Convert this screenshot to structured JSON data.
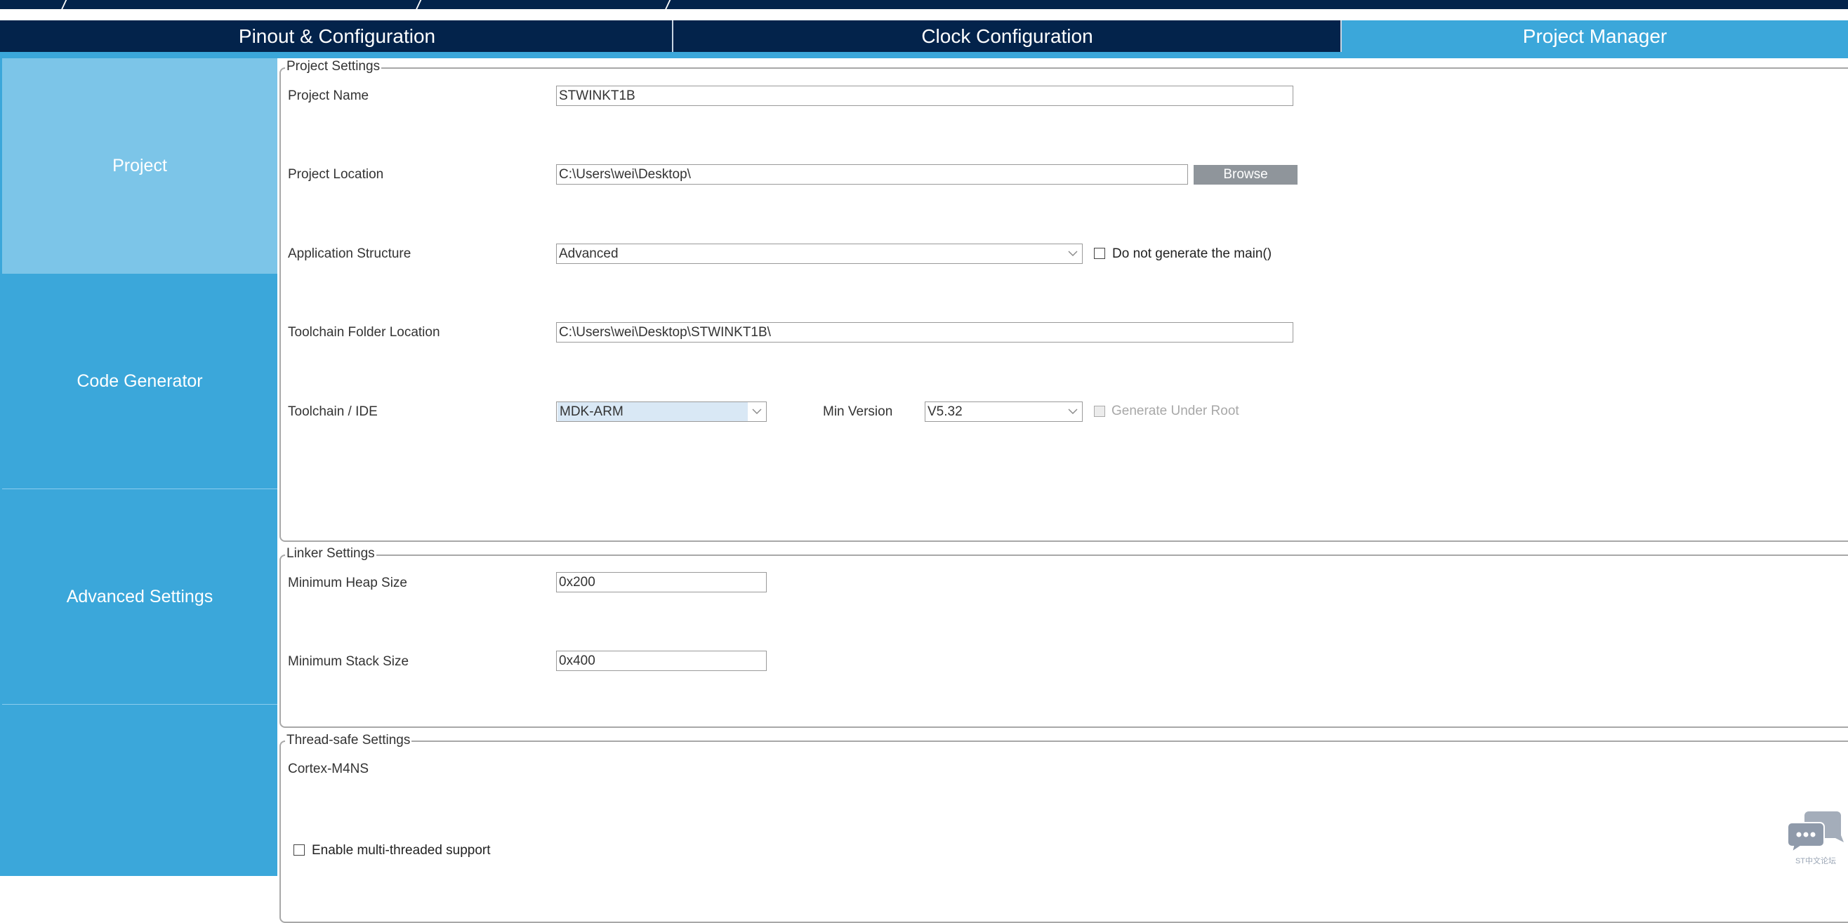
{
  "breadcrumb": {
    "separators": 3
  },
  "tabs": [
    {
      "label": "Pinout & Configuration",
      "active": false
    },
    {
      "label": "Clock Configuration",
      "active": false
    },
    {
      "label": "Project Manager",
      "active": true
    }
  ],
  "sidebar": {
    "items": [
      {
        "label": "Project",
        "active": true
      },
      {
        "label": "Code Generator",
        "active": false
      },
      {
        "label": "Advanced Settings",
        "active": false
      },
      {
        "label": "",
        "active": false
      }
    ]
  },
  "project_settings": {
    "title": "Project Settings",
    "project_name": {
      "label": "Project Name",
      "value": "STWINKT1B"
    },
    "project_location": {
      "label": "Project Location",
      "value": "C:\\Users\\wei\\Desktop\\",
      "browse_label": "Browse"
    },
    "application_structure": {
      "label": "Application Structure",
      "value": "Advanced",
      "checkbox_label": "Do not generate the main()",
      "checked": false
    },
    "toolchain_folder": {
      "label": "Toolchain Folder Location",
      "value": "C:\\Users\\wei\\Desktop\\STWINKT1B\\"
    },
    "toolchain_ide": {
      "label": "Toolchain / IDE",
      "value": "MDK-ARM",
      "min_version_label": "Min Version",
      "min_version_value": "V5.32",
      "generate_under_root_label": "Generate Under Root",
      "generate_under_root_checked": false,
      "generate_under_root_enabled": false
    }
  },
  "linker_settings": {
    "title": "Linker Settings",
    "heap": {
      "label": "Minimum Heap Size",
      "value": "0x200"
    },
    "stack": {
      "label": "Minimum Stack Size",
      "value": "0x400"
    }
  },
  "thread_safe_settings": {
    "title": "Thread-safe Settings",
    "core": "Cortex-M4NS",
    "multithread_label": "Enable multi-threaded support",
    "multithread_checked": false
  },
  "watermark": {
    "icon": "chat-bubbles-icon",
    "text": "ST中文论坛"
  },
  "colors": {
    "nav_dark": "#03234b",
    "accent": "#3ba7da",
    "sidebar_active": "#7cc5e8",
    "button_gray": "#8f959b",
    "selection": "#d9e8f5"
  }
}
